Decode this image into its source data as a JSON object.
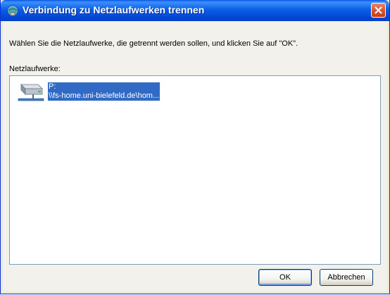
{
  "window": {
    "title": "Verbindung zu Netzlaufwerken trennen"
  },
  "dialog": {
    "instruction": "Wählen Sie die Netzlaufwerke, die getrennt werden sollen, und klicken Sie auf \"OK\".",
    "list_label": "Netzlaufwerke:",
    "drives": [
      {
        "letter": "P:",
        "path": "\\\\fs-home.uni-bielefeld.de\\hom...",
        "icon": "network-drive-icon",
        "selected": true
      }
    ]
  },
  "buttons": {
    "ok_label": "OK",
    "cancel_label": "Abbrechen"
  },
  "colors": {
    "titlebar": "#0b5fe6",
    "selection": "#316ac5",
    "close_button": "#d95534"
  }
}
